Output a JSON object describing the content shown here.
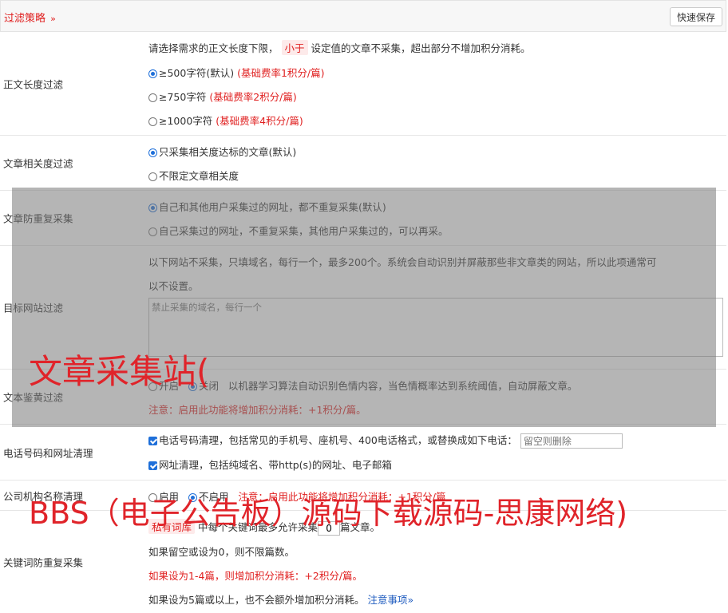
{
  "header": {
    "title": "过滤策略",
    "chevron": "»",
    "save_label": "快速保存"
  },
  "length_filter": {
    "label": "正文长度过滤",
    "desc_pre": "请选择需求的正文长度下限，",
    "desc_pill": "小于",
    "desc_post": "设定值的文章不采集，超出部分不增加积分消耗。",
    "options": [
      {
        "text": "≥500字符(默认)",
        "note": "(基础费率1积分/篇)",
        "selected": true
      },
      {
        "text": "≥750字符",
        "note": "(基础费率2积分/篇)",
        "selected": false
      },
      {
        "text": "≥1000字符",
        "note": "(基础费率4积分/篇)",
        "selected": false
      }
    ]
  },
  "relevance": {
    "label": "文章相关度过滤",
    "options": [
      {
        "text": "只采集相关度达标的文章(默认)",
        "selected": true
      },
      {
        "text": "不限定文章相关度",
        "selected": false
      }
    ]
  },
  "dedupe": {
    "label": "文章防重复采集",
    "options": [
      {
        "text": "自己和其他用户采集过的网址，都不重复采集(默认)",
        "selected": true
      },
      {
        "text": "自己采集过的网址，不重复采集，其他用户采集过的，可以再采。",
        "selected": false
      }
    ]
  },
  "site_filter": {
    "label": "目标网站过滤",
    "desc1": "以下网站不采集，只填域名，每行一个，最多200个。系统会自动识别并屏蔽那些非文章类的网站，所以此项通常可",
    "desc2": "以不设置。",
    "placeholder": "禁止采集的域名，每行一个"
  },
  "porn_filter": {
    "label": "文本鉴黄过滤",
    "on_label": "开启",
    "off_label": "关闭",
    "selected": "关闭",
    "desc": "以机器学习算法自动识别色情内容，当色情概率达到系统阈值，自动屏蔽文章。",
    "note": "注意：启用此功能将增加积分消耗：+1积分/篇。"
  },
  "phone_clean": {
    "label": "电话号码和网址清理",
    "phone_text": "电话号码清理，包括常见的手机号、座机号、400电话格式，或替换成如下电话：",
    "phone_placeholder": "留空则删除",
    "phone_checked": true,
    "url_text": "网址清理，包括纯域名、带http(s)的网址、电子邮箱",
    "url_checked": true
  },
  "org_clean": {
    "label": "公司机构名称清理",
    "on_label": "启用",
    "off_label": "不启用",
    "selected": "不启用",
    "note": "注意：启用此功能将增加积分消耗：+1积分/篇"
  },
  "keyword_dedupe": {
    "label": "关键词防重复采集",
    "line1_pre": "私有词库",
    "line1_mid": "中每个关键词最多允许采集",
    "value": "0",
    "line1_post": "篇文章。",
    "line2": "如果留空或设为0，则不限篇数。",
    "line3": "如果设为1-4篇，则增加积分消耗：+2积分/篇。",
    "line4": "如果设为5篇或以上，也不会额外增加积分消耗。",
    "link": "注意事项",
    "link_chev": "»"
  },
  "watermark": {
    "line1": "文章采集站(",
    "line2": "BBS（电子公告板）源码下载源码-思康网络)"
  }
}
